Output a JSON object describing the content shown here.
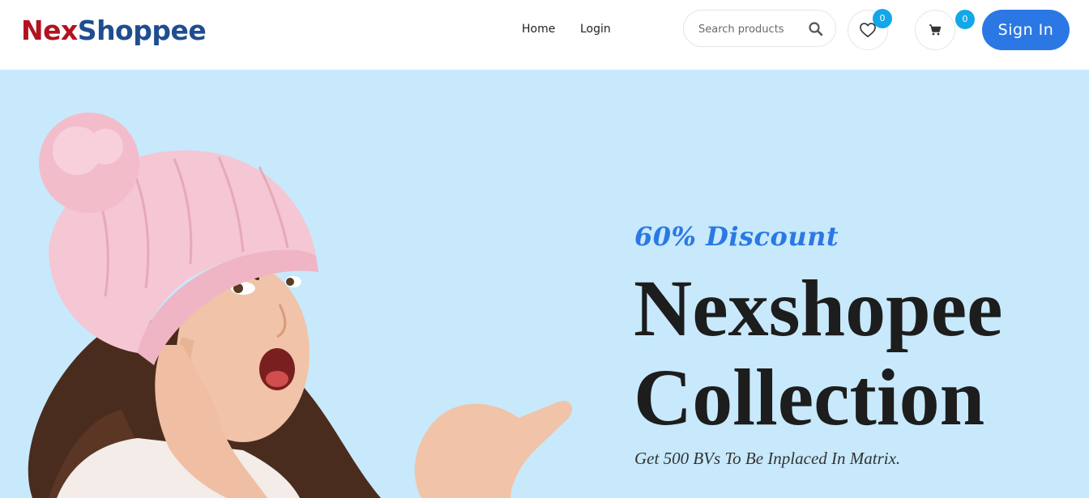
{
  "header": {
    "logo": {
      "part1": "Nex",
      "part2": "Shoppee"
    },
    "nav": {
      "home": "Home",
      "login": "Login"
    },
    "search": {
      "placeholder": "Search products",
      "value": ""
    },
    "wishlist": {
      "icon": "heart-icon",
      "count": "0"
    },
    "cart": {
      "icon": "cart-icon",
      "count": "0"
    },
    "signin_label": "Sign In"
  },
  "hero": {
    "discount": "60% Discount",
    "title_line1": "Nexshopee",
    "title_line2": "Collection",
    "subtitle": "Get 500 BVs To Be Inplaced In Matrix."
  },
  "colors": {
    "brand_red": "#b3121f",
    "brand_blue": "#1f4d8f",
    "accent": "#2b78e4",
    "badge": "#12a7e8",
    "hero_bg": "#c7e9fb"
  }
}
